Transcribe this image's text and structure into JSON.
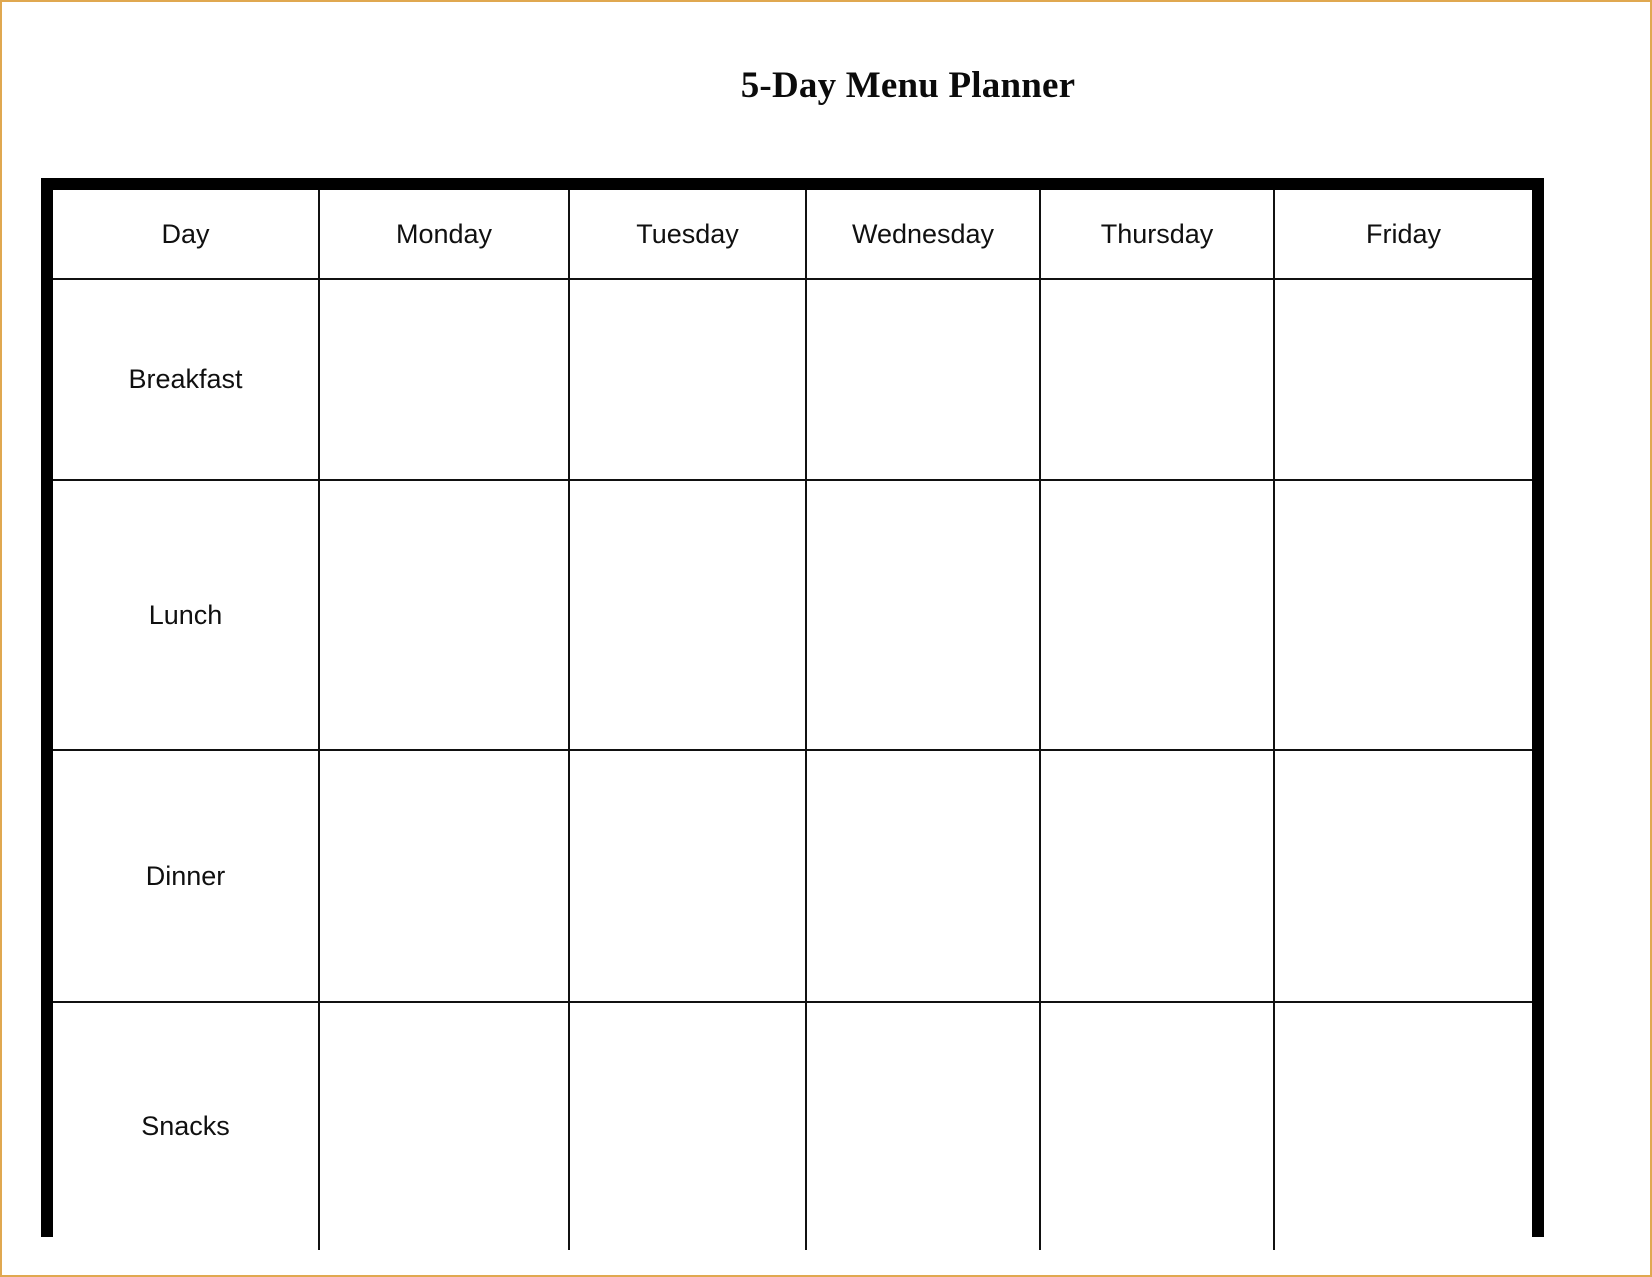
{
  "document": {
    "title": "5-Day Menu Planner",
    "border_color": "#e0a850",
    "table_frame_color": "#000000",
    "grid_line_color": "#111111",
    "background": "#ffffff"
  },
  "table": {
    "columns": [
      {
        "key": "day",
        "label": "Day"
      },
      {
        "key": "monday",
        "label": "Monday"
      },
      {
        "key": "tuesday",
        "label": "Tuesday"
      },
      {
        "key": "wednesday",
        "label": "Wednesday"
      },
      {
        "key": "thursday",
        "label": "Thursday"
      },
      {
        "key": "friday",
        "label": "Friday"
      }
    ],
    "rows": [
      {
        "key": "breakfast",
        "label": "Breakfast",
        "cells": [
          "",
          "",
          "",
          "",
          ""
        ]
      },
      {
        "key": "lunch",
        "label": "Lunch",
        "cells": [
          "",
          "",
          "",
          "",
          ""
        ]
      },
      {
        "key": "dinner",
        "label": "Dinner",
        "cells": [
          "",
          "",
          "",
          "",
          ""
        ]
      },
      {
        "key": "snacks",
        "label": "Snacks",
        "cells": [
          "",
          "",
          "",
          "",
          ""
        ]
      }
    ]
  }
}
